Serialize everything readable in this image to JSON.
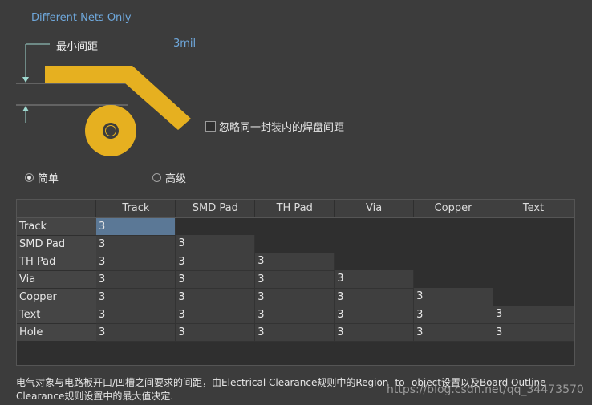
{
  "header": {
    "nets_mode": "Different Nets Only"
  },
  "min_clearance": {
    "label": "最小间距",
    "value": "3mil"
  },
  "ignore_pads": {
    "label": "忽略同一封装内的焊盘间距",
    "checked": false
  },
  "mode": {
    "simple_label": "简单",
    "advanced_label": "高级",
    "selected": "simple"
  },
  "matrix": {
    "columns": [
      "Track",
      "SMD Pad",
      "TH Pad",
      "Via",
      "Copper",
      "Text"
    ],
    "rows": [
      {
        "name": "Track",
        "values": [
          "3"
        ]
      },
      {
        "name": "SMD Pad",
        "values": [
          "3",
          "3"
        ]
      },
      {
        "name": "TH Pad",
        "values": [
          "3",
          "3",
          "3"
        ]
      },
      {
        "name": "Via",
        "values": [
          "3",
          "3",
          "3",
          "3"
        ]
      },
      {
        "name": "Copper",
        "values": [
          "3",
          "3",
          "3",
          "3",
          "3"
        ]
      },
      {
        "name": "Text",
        "values": [
          "3",
          "3",
          "3",
          "3",
          "3",
          "3"
        ]
      },
      {
        "name": "Hole",
        "values": [
          "3",
          "3",
          "3",
          "3",
          "3",
          "3"
        ]
      }
    ]
  },
  "description": "电气对象与电路板开口/凹槽之间要求的间距，由Electrical Clearance规则中的Region -to- object设置以及Board Outline Clearance规则设置中的最大值决定.",
  "watermark": "https://blog.csdn.net/qq_34473570",
  "colors": {
    "copper": "#e6b020",
    "accent_blue": "#6fa8dc",
    "selection": "#5b7896"
  }
}
